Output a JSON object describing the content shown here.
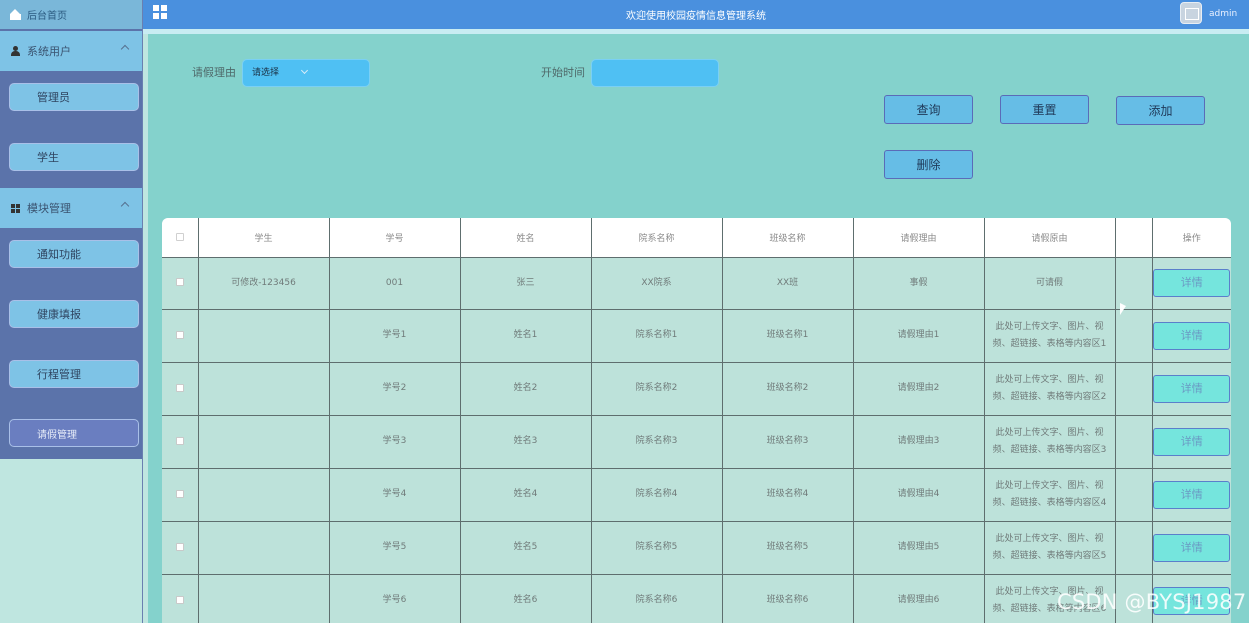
{
  "sidebar": {
    "home_label": "后台首页",
    "groups": [
      {
        "label": "系统用户",
        "items": [
          "管理员",
          "学生"
        ]
      },
      {
        "label": "模块管理",
        "items": [
          "通知功能",
          "健康填报",
          "行程管理",
          "请假管理"
        ]
      }
    ],
    "active_item": "请假管理"
  },
  "header": {
    "title": "欢迎使用校园疫情信息管理系统",
    "user": "admin"
  },
  "search": {
    "reason_label": "请假理由",
    "reason_select_value": "请选择",
    "start_time_label": "开始时间",
    "start_time_value": ""
  },
  "actions": {
    "query": "查询",
    "reset": "重置",
    "add": "添加",
    "delete": "删除"
  },
  "table": {
    "headers": [
      "学生",
      "学号",
      "姓名",
      "院系名称",
      "班级名称",
      "请假理由",
      "请假原由",
      "",
      "操作"
    ],
    "detail_label": "详情",
    "rows": [
      {
        "student": "可修改-123456",
        "id": "001",
        "name": "张三",
        "dept": "XX院系",
        "cls": "XX班",
        "reason": "事假",
        "cause": "可请假"
      },
      {
        "student": "",
        "id": "学号1",
        "name": "姓名1",
        "dept": "院系名称1",
        "cls": "班级名称1",
        "reason": "请假理由1",
        "cause": "此处可上传文字、图片、视频、超链接、表格等内容区1"
      },
      {
        "student": "",
        "id": "学号2",
        "name": "姓名2",
        "dept": "院系名称2",
        "cls": "班级名称2",
        "reason": "请假理由2",
        "cause": "此处可上传文字、图片、视频、超链接、表格等内容区2"
      },
      {
        "student": "",
        "id": "学号3",
        "name": "姓名3",
        "dept": "院系名称3",
        "cls": "班级名称3",
        "reason": "请假理由3",
        "cause": "此处可上传文字、图片、视频、超链接、表格等内容区3"
      },
      {
        "student": "",
        "id": "学号4",
        "name": "姓名4",
        "dept": "院系名称4",
        "cls": "班级名称4",
        "reason": "请假理由4",
        "cause": "此处可上传文字、图片、视频、超链接、表格等内容区4"
      },
      {
        "student": "",
        "id": "学号5",
        "name": "姓名5",
        "dept": "院系名称5",
        "cls": "班级名称5",
        "reason": "请假理由5",
        "cause": "此处可上传文字、图片、视频、超链接、表格等内容区5"
      },
      {
        "student": "",
        "id": "学号6",
        "name": "姓名6",
        "dept": "院系名称6",
        "cls": "班级名称6",
        "reason": "请假理由6",
        "cause": "此处可上传文字、图片、视频、超链接、表格等内容区6"
      }
    ]
  },
  "watermark": "CSDN @BYSJ1987"
}
